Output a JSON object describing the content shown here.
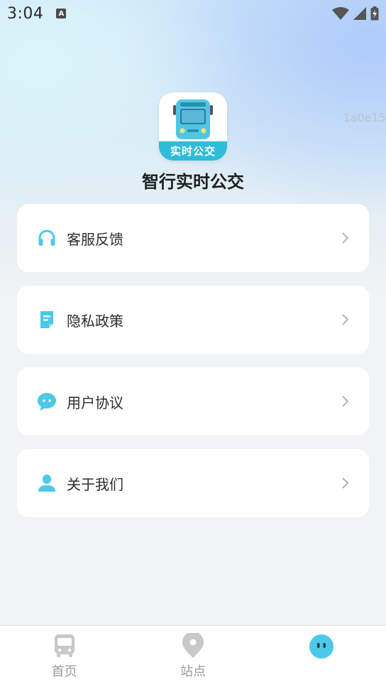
{
  "status_bar": {
    "time": "3:04",
    "indicator": "A",
    "icons": [
      "wifi-icon",
      "signal-icon",
      "battery-charging-icon"
    ]
  },
  "debug_id": "1a0e15",
  "app": {
    "logo_text": "实时公交",
    "name": "智行实时公交"
  },
  "menu": [
    {
      "label": "客服反馈",
      "icon": "headphones-icon"
    },
    {
      "label": "隐私政策",
      "icon": "document-icon"
    },
    {
      "label": "用户协议",
      "icon": "chat-bubble-icon"
    },
    {
      "label": "关于我们",
      "icon": "user-icon"
    }
  ],
  "tabbar": {
    "tabs": [
      {
        "label": "首页",
        "icon": "bus-icon",
        "active": false
      },
      {
        "label": "站点",
        "icon": "location-pin-icon",
        "active": false
      },
      {
        "label": "",
        "icon": "profile-face-icon",
        "active": true
      }
    ]
  },
  "colors": {
    "accent": "#4cc8e8",
    "logo_band": "#2fbcd8",
    "inactive": "#c8c8c8",
    "text": "#2d2d2d"
  }
}
